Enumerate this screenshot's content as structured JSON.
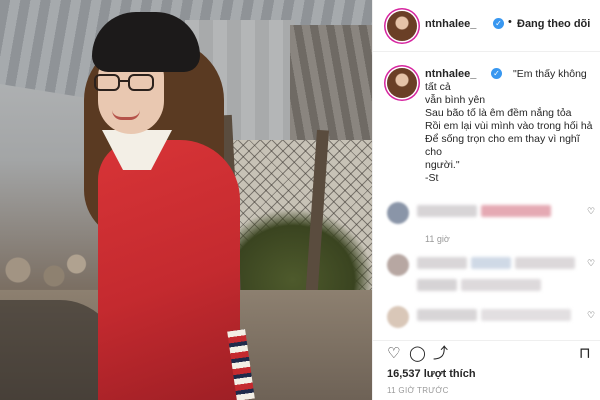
{
  "post": {
    "username": "ntnhalee_",
    "follow_status": "Đang theo dõi",
    "dot": "•",
    "verified_mark": "✓",
    "caption": {
      "username": "ntnhalee_",
      "lines": [
        "\"Em thấy không tất cả",
        "vẫn bình yên",
        "Sau bão tố là êm đềm nắng tỏa",
        "Rồi em lại vùi mình vào trong hối hả",
        "Để sống trọn cho em thay vì nghĩ cho",
        "người.\"",
        "-St"
      ],
      "time": "11 giờ"
    },
    "comments_blurred": true,
    "likes": "16,537 lượt thích",
    "timestamp": "11 GIỜ TRƯỚC"
  },
  "icons": {
    "like": "heart-icon",
    "comment": "comment-icon",
    "share": "share-icon",
    "save": "bookmark-icon"
  },
  "colors": {
    "verified": "#3897f0",
    "sweater": "#c42a2f",
    "text": "#262626",
    "muted": "#999999"
  }
}
